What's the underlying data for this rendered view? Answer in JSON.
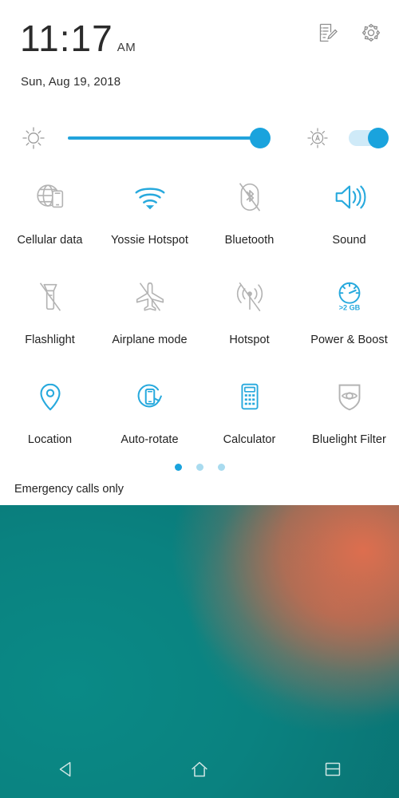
{
  "header": {
    "clock_time": "11:17",
    "clock_ampm": "AM",
    "date": "Sun, Aug 19, 2018",
    "icons": [
      {
        "name": "edit-notes-icon",
        "label": "Edit quick settings"
      },
      {
        "name": "gear-icon",
        "label": "Settings"
      }
    ]
  },
  "brightness": {
    "sun_icon": "brightness-low-icon",
    "slider_value": 93,
    "slider_min": 0,
    "slider_max": 100,
    "auto_icon": "auto-brightness-icon",
    "auto_enabled": true,
    "auto_toggle_state": "on"
  },
  "tiles": [
    [
      {
        "label": "Cellular data",
        "icon": "cellular-data-icon",
        "state": "off"
      },
      {
        "label": "Yossie Hotspot",
        "icon": "wifi-icon",
        "state": "on"
      },
      {
        "label": "Bluetooth",
        "icon": "bluetooth-off-icon",
        "state": "off"
      },
      {
        "label": "Sound",
        "icon": "sound-icon",
        "state": "on"
      }
    ],
    [
      {
        "label": "Flashlight",
        "icon": "flashlight-off-icon",
        "state": "off"
      },
      {
        "label": "Airplane mode",
        "icon": "airplane-off-icon",
        "state": "off"
      },
      {
        "label": "Hotspot",
        "icon": "hotspot-off-icon",
        "state": "off"
      },
      {
        "label": "Power & Boost",
        "icon": "power-boost-icon",
        "state": "on",
        "badge": ">2 GB"
      }
    ],
    [
      {
        "label": "Location",
        "icon": "location-pin-icon",
        "state": "on"
      },
      {
        "label": "Auto-rotate",
        "icon": "auto-rotate-icon",
        "state": "on"
      },
      {
        "label": "Calculator",
        "icon": "calculator-icon",
        "state": "on"
      },
      {
        "label": "Bluelight Filter",
        "icon": "bluelight-filter-icon",
        "state": "off"
      }
    ]
  ],
  "pager": {
    "total_pages": 3,
    "active_page": 1
  },
  "status": {
    "carrier_text": "Emergency calls only"
  },
  "navbar": [
    {
      "name": "back-button",
      "icon": "back-triangle-icon"
    },
    {
      "name": "home-button",
      "icon": "home-icon"
    },
    {
      "name": "recents-button",
      "icon": "recents-icon"
    }
  ],
  "colors": {
    "accent_blue": "#1aa3dd",
    "tile_on": "#27a9dd",
    "tile_off": "#b3b3b3",
    "panel_bg": "#ffffff",
    "text_primary": "#232323",
    "dot_inactive": "#a9dbef"
  }
}
